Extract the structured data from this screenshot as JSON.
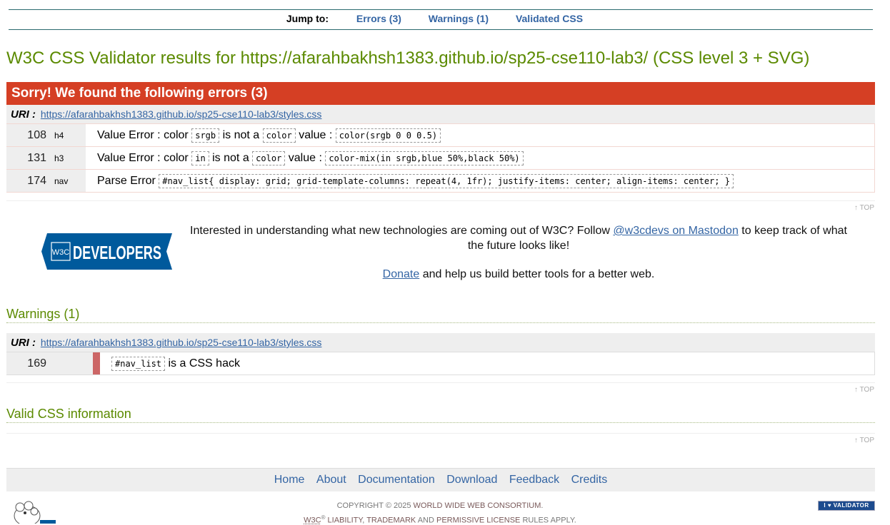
{
  "jump": {
    "label": "Jump to:",
    "links": [
      "Errors (3)",
      "Warnings (1)",
      "Validated CSS"
    ]
  },
  "title": "W3C CSS Validator results for https://afarahbakhsh1383.github.io/sp25-cse110-lab3/ (CSS level 3 + SVG)",
  "errors": {
    "heading": "Sorry! We found the following errors (3)",
    "uri_label": "URI :",
    "uri": "https://afarahbakhsh1383.github.io/sp25-cse110-lab3/styles.css",
    "rows": [
      {
        "line": "108",
        "context": "h4",
        "kind": "Value Error :",
        "prop": "color",
        "bad": "srgb",
        "mid1": "is not a",
        "type": "color",
        "mid2": "value :",
        "value": "color(srgb 0 0 0.5)"
      },
      {
        "line": "131",
        "context": "h3",
        "kind": "Value Error :",
        "prop": "color",
        "bad": "in",
        "mid1": "is not a",
        "type": "color",
        "mid2": "value :",
        "value": "color-mix(in srgb,blue 50%,black 50%)"
      },
      {
        "line": "174",
        "context": "nav",
        "kind": "Parse Error",
        "code": "#nav_list{ display: grid; grid-template-columns: repeat(4, 1fr); justify-items: center; align-items: center; }"
      }
    ]
  },
  "top_label": "↑ TOP",
  "devbanner": {
    "logo_text": "DEVELOPERS",
    "logo_w3c": "W3C",
    "text_before": "Interested in understanding what new technologies are coming out of W3C? Follow",
    "mastodon_link": "@w3cdevs on Mastodon",
    "text_after": "to keep track of what the future looks like!",
    "donate_link": "Donate",
    "donate_after": "and help us build better tools for a better web."
  },
  "warnings": {
    "heading": "Warnings (1)",
    "uri_label": "URI :",
    "uri": "https://afarahbakhsh1383.github.io/sp25-cse110-lab3/styles.css",
    "rows": [
      {
        "line": "169",
        "code": "#nav_list",
        "message": "is a CSS hack"
      }
    ]
  },
  "valid_heading": "Valid CSS information",
  "footer": {
    "nav": [
      "Home",
      "About",
      "Documentation",
      "Download",
      "Feedback",
      "Credits"
    ],
    "copyright_prefix": "Copyright © 2025",
    "consortium": "World Wide Web Consortium",
    "line2_w3c": "W3C",
    "line2_sup": "®",
    "liability": "liability",
    "trademark": "trademark",
    "and": "and",
    "permissive": "permissive license",
    "rules": "rules apply.",
    "badge": "I ♥ VALIDATOR"
  },
  "colors": {
    "error_red": "#d53f24",
    "heading_green": "#5b8a00",
    "link_blue": "#3465a4",
    "warning_bar": "#cc6666",
    "dev_blue": "#005a9c"
  }
}
